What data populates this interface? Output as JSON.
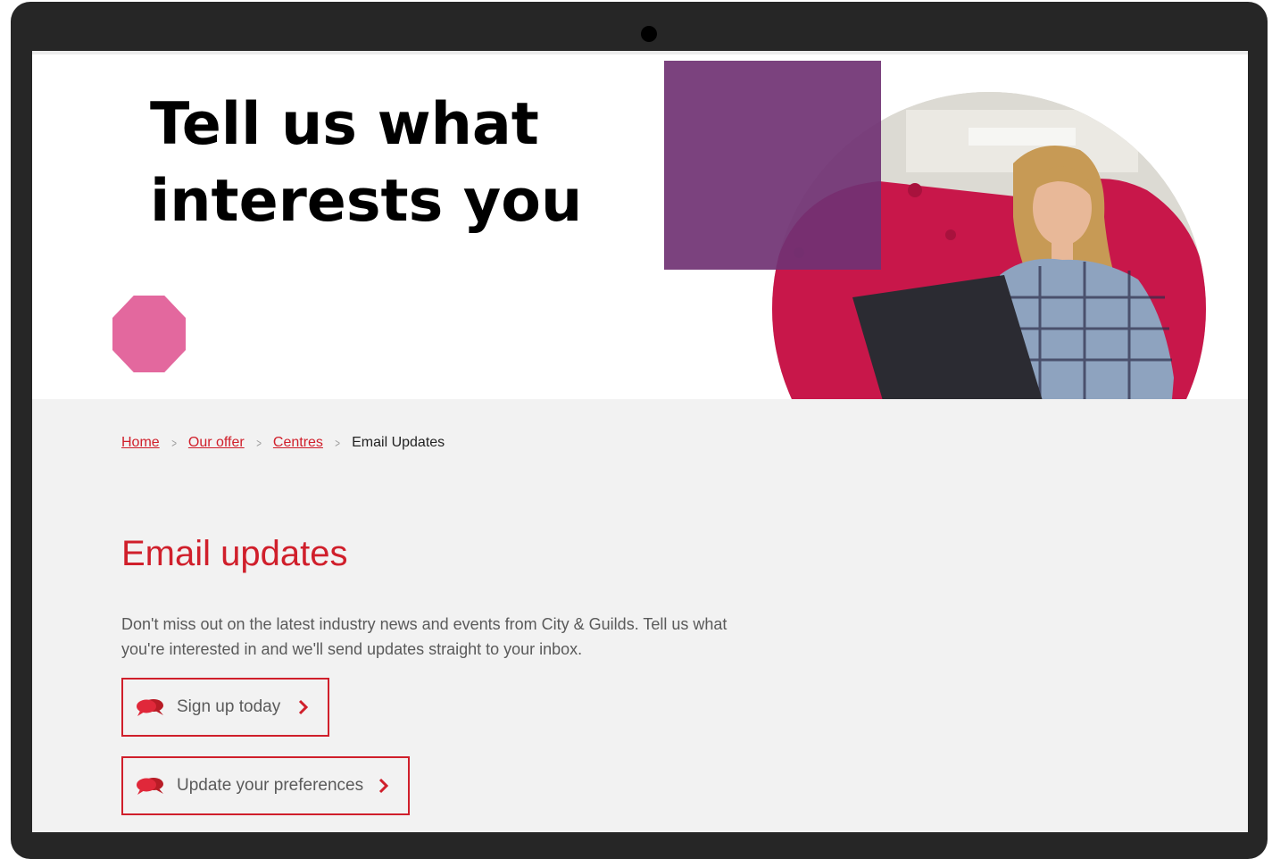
{
  "hero": {
    "title_line1": "Tell us what",
    "title_line2": "interests you"
  },
  "breadcrumb": {
    "items": [
      {
        "label": "Home",
        "link": true
      },
      {
        "label": "Our offer",
        "link": true
      },
      {
        "label": "Centres",
        "link": true
      },
      {
        "label": "Email Updates",
        "link": false
      }
    ],
    "separator": ">"
  },
  "main": {
    "title": "Email updates",
    "intro": "Don't miss out on the latest industry news and events from City & Guilds. Tell us what you're interested in and we'll send updates straight to your inbox.",
    "buttons": [
      {
        "label": "Sign up today",
        "icon": "speech-bubbles-icon",
        "arrow_icon": "chevron-right-icon"
      },
      {
        "label": "Update your preferences",
        "icon": "speech-bubbles-icon",
        "arrow_icon": "chevron-right-icon"
      }
    ]
  },
  "colors": {
    "brand_red": "#d01f2b",
    "purple": "#703273",
    "pink": "#e3689e",
    "background": "#f2f2f2"
  }
}
